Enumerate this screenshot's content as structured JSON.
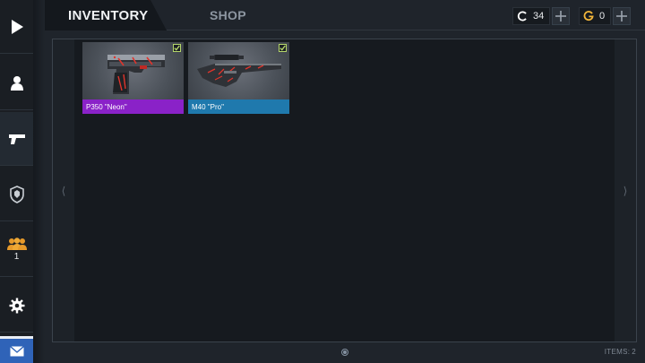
{
  "tabs": {
    "inventory": "INVENTORY",
    "shop": "SHOP"
  },
  "currencies": [
    {
      "icon": "credits-icon",
      "value": "34"
    },
    {
      "icon": "gold-icon",
      "value": "0"
    }
  ],
  "sidebar": {
    "items": [
      {
        "icon": "play-icon"
      },
      {
        "icon": "profile-icon"
      },
      {
        "icon": "pistol-icon",
        "active": true
      },
      {
        "icon": "clan-shield-icon"
      },
      {
        "icon": "friends-icon",
        "count": "1"
      },
      {
        "icon": "gear-icon"
      },
      {
        "icon": "mail-icon"
      }
    ]
  },
  "inventory_items": [
    {
      "name": "P350 \"Neon\"",
      "rarity_color": "#8a22c8",
      "equipped": true,
      "icon": "pistol-image"
    },
    {
      "name": "M40 \"Pro\"",
      "rarity_color": "#1f79ad",
      "equipped": true,
      "icon": "sniper-rifle-image"
    }
  ],
  "footer": {
    "items_label": "ITEMS:",
    "items_count": "2"
  },
  "colors": {
    "accent_blue": "#2f63b8",
    "check_green": "#b5d66a"
  }
}
